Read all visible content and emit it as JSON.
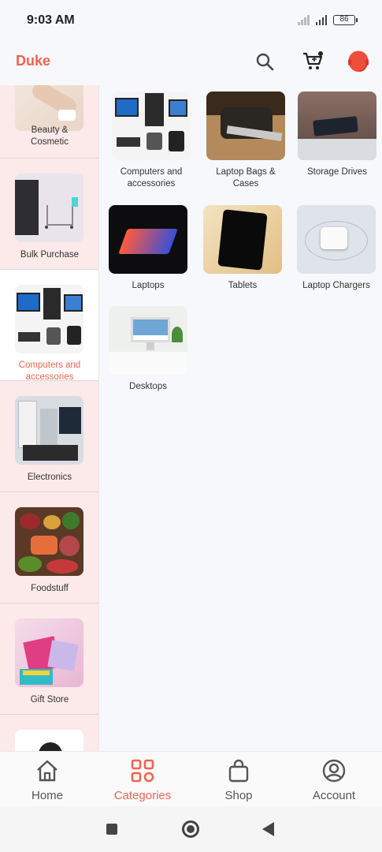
{
  "status": {
    "time": "9:03 AM",
    "battery": "86"
  },
  "app": {
    "brand": "Duke"
  },
  "colors": {
    "accent": "#ef6450",
    "sidebar_bg": "#fce9ea"
  },
  "sidebar": {
    "items": [
      {
        "label": "Beauty &\nCosmetic",
        "icon": "beauty-cosmetic-image"
      },
      {
        "label": "Bulk Purchase",
        "icon": "bulk-purchase-image"
      },
      {
        "label": "Computers and\naccessories",
        "icon": "computers-image",
        "active": true
      },
      {
        "label": "Electronics",
        "icon": "electronics-image"
      },
      {
        "label": "Foodstuff",
        "icon": "foodstuff-image"
      },
      {
        "label": "Gift Store",
        "icon": "gift-store-image"
      }
    ]
  },
  "subcategories": [
    {
      "label": "Computers and\naccessories"
    },
    {
      "label": "Laptop Bags &\nCases"
    },
    {
      "label": "Storage Drives"
    },
    {
      "label": "Laptops"
    },
    {
      "label": "Tablets"
    },
    {
      "label": "Laptop Chargers"
    },
    {
      "label": "Desktops"
    }
  ],
  "bottom_nav": {
    "home": "Home",
    "categories": "Categories",
    "shop": "Shop",
    "account": "Account"
  }
}
